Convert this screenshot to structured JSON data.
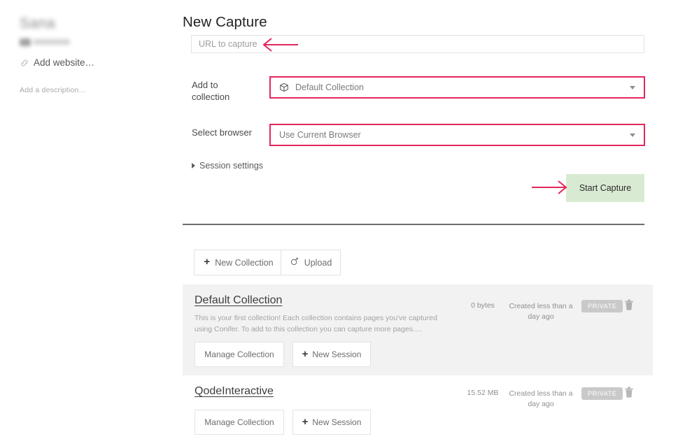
{
  "sidebar": {
    "user_name_redacted": "Sana",
    "add_website_label": "Add website…",
    "add_description_label": "Add a description…",
    "link_icon": "link-icon"
  },
  "main": {
    "page_title": "New Capture",
    "url_field": {
      "value": "",
      "placeholder": "URL to capture"
    },
    "collection_row": {
      "label": "Add to collection",
      "selected": "Default Collection",
      "icon": "package-box-icon",
      "chevron": "chevron-down-icon"
    },
    "browser_row": {
      "label": "Select browser",
      "selected": "Use Current Browser",
      "chevron": "chevron-down-icon"
    },
    "session_settings": {
      "label": "Session settings",
      "toggle_icon": "triangle-right-icon",
      "expanded": false
    },
    "start_capture_label": "Start Capture",
    "toolbar": {
      "new_collection_label": "New Collection",
      "new_collection_icon": "plus-icon",
      "upload_label": "Upload",
      "upload_icon": "cloud-upload-icon"
    }
  },
  "collections": [
    {
      "title": "Default Collection",
      "description": "This is your first collection! Each collection contains pages you've captured using Conifer. To add to this collection you can capture more pages.…",
      "size": "0 bytes",
      "created": "Created less than a day ago",
      "visibility": "PRIVATE",
      "delete_icon": "trash-icon",
      "manage_label": "Manage Collection",
      "new_session_label": "New Session",
      "new_session_icon": "plus-icon"
    },
    {
      "title": "QodeInteractive",
      "description": "",
      "size": "15.52 MB",
      "created": "Created less than a day ago",
      "visibility": "PRIVATE",
      "delete_icon": "trash-icon",
      "manage_label": "Manage Collection",
      "new_session_label": "New Session",
      "new_session_icon": "plus-icon"
    }
  ],
  "annotations": {
    "highlight_color": "#e4275c",
    "arrows": [
      {
        "name": "arrow-to-url-field",
        "direction": "left"
      },
      {
        "name": "arrow-to-start-capture",
        "direction": "right"
      }
    ],
    "highlighted_fields": [
      "collection-select",
      "browser-select"
    ]
  },
  "colors": {
    "accent_crimson": "#e4275c",
    "start_capture_green": "#d9ead3",
    "card_gray": "#f2f2f2",
    "badge_gray": "#c9c9c9"
  }
}
